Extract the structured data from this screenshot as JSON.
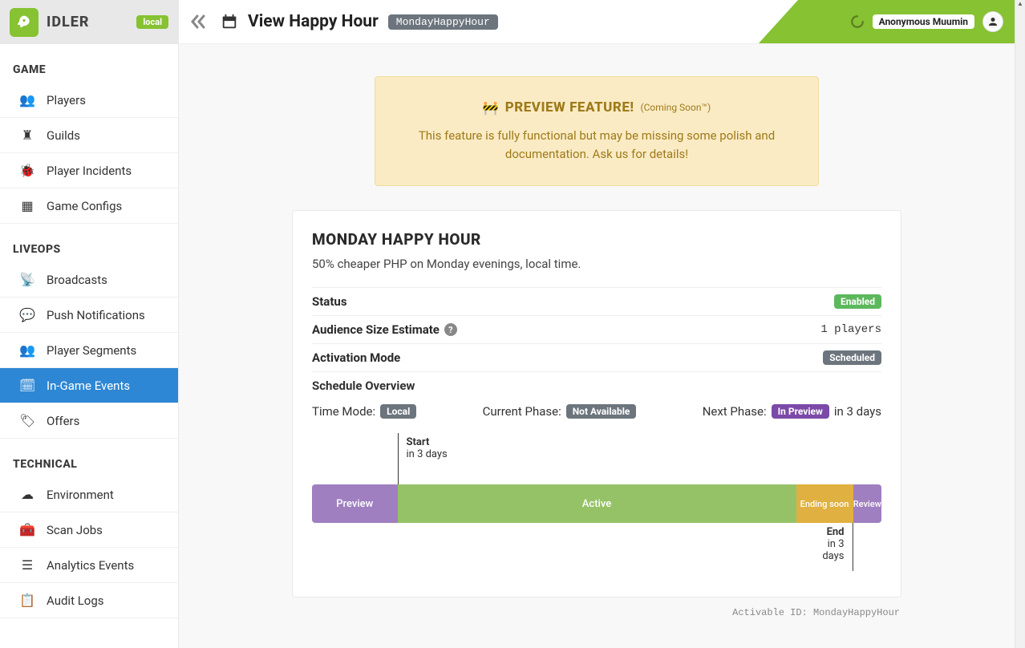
{
  "app": {
    "name": "IDLER",
    "env": "local"
  },
  "user": {
    "name": "Anonymous Muumin"
  },
  "page": {
    "title": "View Happy Hour",
    "slug": "MondayHappyHour"
  },
  "sidebar": {
    "sections": [
      {
        "title": "GAME",
        "items": [
          {
            "label": "Players",
            "icon": "users"
          },
          {
            "label": "Guilds",
            "icon": "tower"
          },
          {
            "label": "Player Incidents",
            "icon": "bug"
          },
          {
            "label": "Game Configs",
            "icon": "table"
          }
        ]
      },
      {
        "title": "LIVEOPS",
        "items": [
          {
            "label": "Broadcasts",
            "icon": "broadcast"
          },
          {
            "label": "Push Notifications",
            "icon": "comment"
          },
          {
            "label": "Player Segments",
            "icon": "users"
          },
          {
            "label": "In-Game Events",
            "icon": "calendar",
            "active": true
          },
          {
            "label": "Offers",
            "icon": "tags"
          }
        ]
      },
      {
        "title": "TECHNICAL",
        "items": [
          {
            "label": "Environment",
            "icon": "cloud"
          },
          {
            "label": "Scan Jobs",
            "icon": "toolbox"
          },
          {
            "label": "Analytics Events",
            "icon": "list"
          },
          {
            "label": "Audit Logs",
            "icon": "clipboard"
          }
        ]
      }
    ]
  },
  "preview_banner": {
    "title": "PREVIEW FEATURE!",
    "subtitle": "(Coming Soon™)",
    "desc": "This feature is fully functional but may be missing some polish and documentation. Ask us for details!"
  },
  "event": {
    "title": "MONDAY HAPPY HOUR",
    "desc": "50% cheaper PHP on Monday evenings, local time.",
    "status_label": "Status",
    "status_value": "Enabled",
    "audience_label": "Audience Size Estimate",
    "audience_value": "1 players",
    "activation_label": "Activation Mode",
    "activation_value": "Scheduled",
    "schedule_header": "Schedule Overview",
    "time_mode_label": "Time Mode:",
    "time_mode_value": "Local",
    "current_phase_label": "Current Phase:",
    "current_phase_value": "Not Available",
    "next_phase_label": "Next Phase:",
    "next_phase_value": "In Preview",
    "next_phase_eta": "in 3 days",
    "timeline": {
      "start_label": "Start",
      "start_eta": "in 3 days",
      "end_label": "End",
      "end_eta": "in 3 days",
      "segments": {
        "preview": "Preview",
        "active": "Active",
        "ending": "Ending soon",
        "review": "Review"
      }
    }
  },
  "footer": {
    "activable_id_label": "Activable ID:",
    "activable_id_value": "MondayHappyHour"
  }
}
